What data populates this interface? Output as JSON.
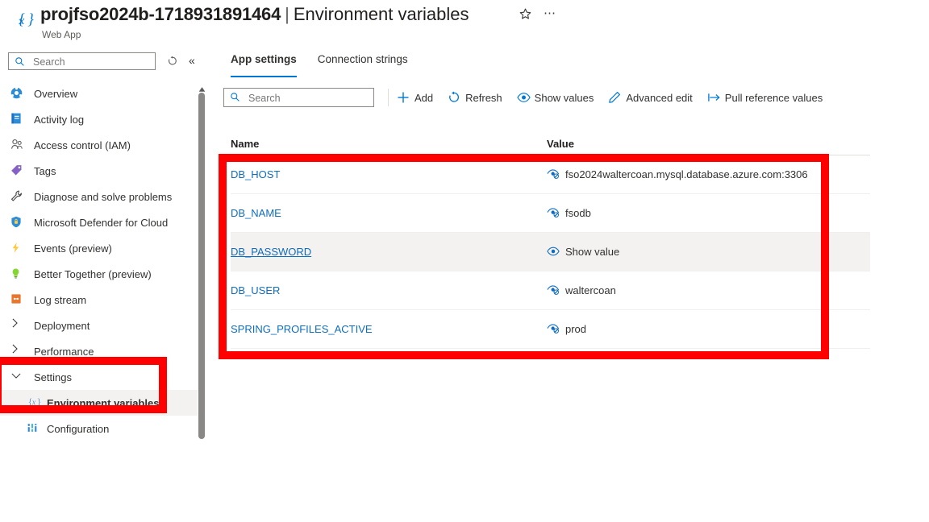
{
  "header": {
    "icon": "braces-x-icon",
    "resource_name": "projfso2024b-1718931891464",
    "separator": "|",
    "blade_title": "Environment variables",
    "resource_type": "Web App",
    "favorite_icon": "star-icon",
    "more_icon": "ellipsis-icon"
  },
  "sidebar": {
    "search": {
      "placeholder": "Search",
      "value": "",
      "icon": "search-icon"
    },
    "refresh_icon": "refresh-icon",
    "collapse_icon": "double-chevron-left-icon",
    "items": [
      {
        "label": "Overview",
        "icon": "overview-icon",
        "type": "leaf",
        "selected": false
      },
      {
        "label": "Activity log",
        "icon": "activity-log-icon",
        "type": "leaf",
        "selected": false
      },
      {
        "label": "Access control (IAM)",
        "icon": "access-control-icon",
        "type": "leaf",
        "selected": false
      },
      {
        "label": "Tags",
        "icon": "tag-icon",
        "type": "leaf",
        "selected": false
      },
      {
        "label": "Diagnose and solve problems",
        "icon": "wrench-icon",
        "type": "leaf",
        "selected": false
      },
      {
        "label": "Microsoft Defender for Cloud",
        "icon": "shield-icon",
        "type": "leaf",
        "selected": false
      },
      {
        "label": "Events (preview)",
        "icon": "lightning-icon",
        "type": "leaf",
        "selected": false
      },
      {
        "label": "Better Together (preview)",
        "icon": "lightbulb-icon",
        "type": "leaf",
        "selected": false
      },
      {
        "label": "Log stream",
        "icon": "log-stream-icon",
        "type": "leaf",
        "selected": false
      },
      {
        "label": "Deployment",
        "icon": "chevron-right-icon",
        "type": "group-collapsed",
        "selected": false
      },
      {
        "label": "Performance",
        "icon": "chevron-right-icon",
        "type": "group-collapsed",
        "selected": false
      },
      {
        "label": "Settings",
        "icon": "chevron-down-icon",
        "type": "group-expanded",
        "selected": false
      },
      {
        "label": "Environment variables",
        "icon": "braces-x-icon",
        "type": "child",
        "selected": true
      },
      {
        "label": "Configuration",
        "icon": "configuration-icon",
        "type": "child",
        "selected": false
      }
    ]
  },
  "main": {
    "tabs": [
      {
        "label": "App settings",
        "active": true
      },
      {
        "label": "Connection strings",
        "active": false
      }
    ],
    "search": {
      "placeholder": "Search",
      "value": "",
      "icon": "search-icon"
    },
    "toolbar": [
      {
        "label": "Add",
        "icon": "plus-icon"
      },
      {
        "label": "Refresh",
        "icon": "refresh-icon"
      },
      {
        "label": "Show values",
        "icon": "eye-icon"
      },
      {
        "label": "Advanced edit",
        "icon": "pencil-icon"
      },
      {
        "label": "Pull reference values",
        "icon": "pull-arrow-icon"
      }
    ],
    "table": {
      "columns": [
        "Name",
        "Value"
      ],
      "show_value_label": "Show value",
      "rows": [
        {
          "name": "DB_HOST",
          "value": "fso2024waltercoan.mysql.database.azure.com:3306",
          "value_icon": "hidden-eye-icon",
          "hidden": false,
          "highlight": false
        },
        {
          "name": "DB_NAME",
          "value": "fsodb",
          "value_icon": "hidden-eye-icon",
          "hidden": false,
          "highlight": false
        },
        {
          "name": "DB_PASSWORD",
          "value": "Show value",
          "value_icon": "eye-icon",
          "hidden": true,
          "highlight": true
        },
        {
          "name": "DB_USER",
          "value": "waltercoan",
          "value_icon": "hidden-eye-icon",
          "hidden": false,
          "highlight": false
        },
        {
          "name": "SPRING_PROFILES_ACTIVE",
          "value": "prod",
          "value_icon": "hidden-eye-icon",
          "hidden": false,
          "highlight": false
        }
      ]
    }
  },
  "annotations": {
    "color": "#ff0000",
    "boxes": [
      {
        "target": "environment-variables-table"
      },
      {
        "target": "sidebar-settings-environment-variables"
      }
    ]
  }
}
